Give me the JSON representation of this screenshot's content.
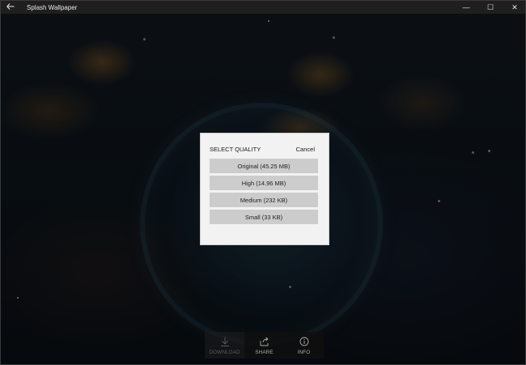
{
  "window": {
    "title": "Splash Wallpaper",
    "back_icon": "back-arrow-icon",
    "controls": {
      "minimize": "—",
      "maximize": "☐",
      "close": "✕"
    }
  },
  "dialog": {
    "title": "SELECT QUALITY",
    "cancel_label": "Cancel",
    "options": [
      {
        "label": "Original (45.25 MB)"
      },
      {
        "label": "High (14.96 MB)"
      },
      {
        "label": "Medium (232 KB)"
      },
      {
        "label": "Small (33 KB)"
      }
    ]
  },
  "bottom_bar": {
    "download": {
      "label": "DOWNLOAD",
      "icon": "download-icon"
    },
    "share": {
      "label": "SHARE",
      "icon": "share-icon"
    },
    "info": {
      "label": "INFO",
      "icon": "info-icon"
    }
  },
  "colors": {
    "titlebar": "#1f1f1f",
    "dialog_bg": "#f2f2f2",
    "option_bg": "#cccccc"
  }
}
